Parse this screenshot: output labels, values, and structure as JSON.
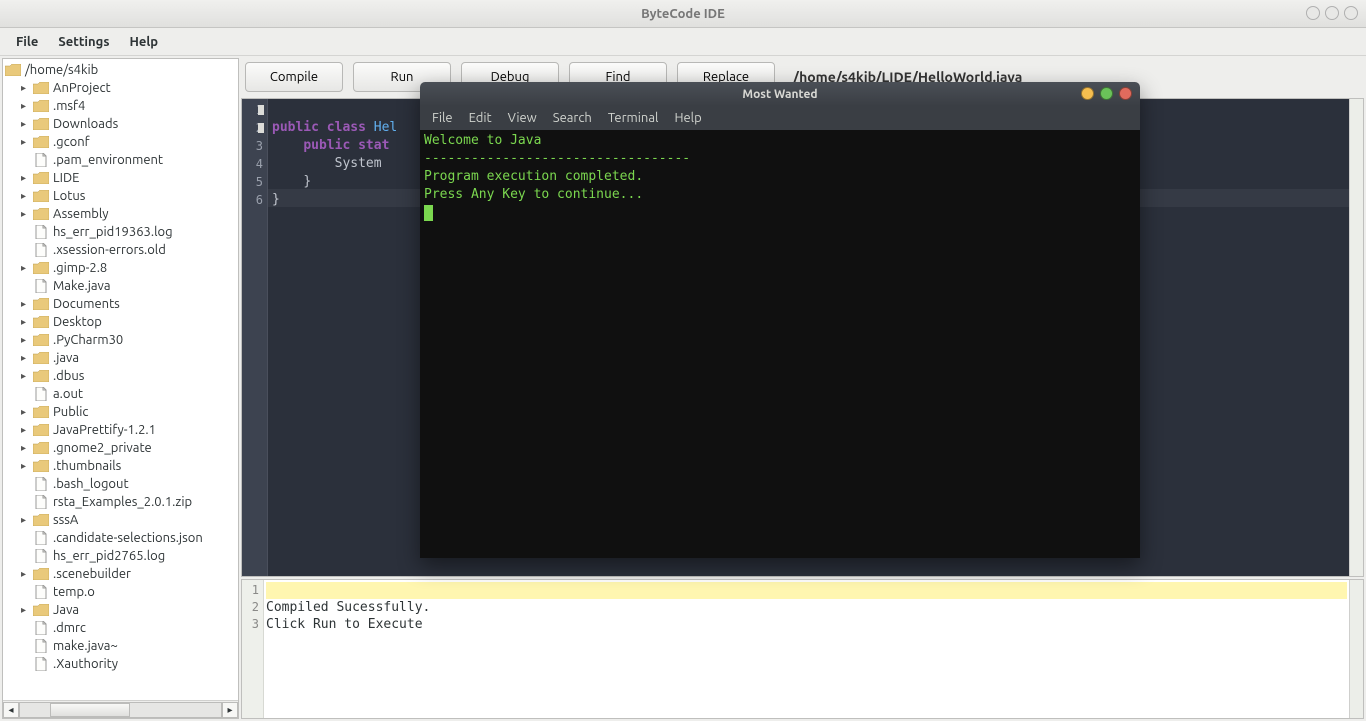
{
  "window": {
    "title": "ByteCode IDE"
  },
  "menubar": [
    "File",
    "Settings",
    "Help"
  ],
  "filetree": {
    "root": "/home/s4kib",
    "nodes": [
      {
        "type": "folder",
        "expandable": true,
        "name": "AnProject"
      },
      {
        "type": "folder",
        "expandable": true,
        "name": ".msf4"
      },
      {
        "type": "folder",
        "expandable": true,
        "name": "Downloads"
      },
      {
        "type": "folder",
        "expandable": true,
        "name": ".gconf"
      },
      {
        "type": "file",
        "expandable": false,
        "name": ".pam_environment"
      },
      {
        "type": "folder",
        "expandable": true,
        "name": "LIDE"
      },
      {
        "type": "folder",
        "expandable": true,
        "name": "Lotus"
      },
      {
        "type": "folder",
        "expandable": true,
        "name": "Assembly"
      },
      {
        "type": "file",
        "expandable": false,
        "name": "hs_err_pid19363.log"
      },
      {
        "type": "file",
        "expandable": false,
        "name": ".xsession-errors.old"
      },
      {
        "type": "folder",
        "expandable": true,
        "name": ".gimp-2.8"
      },
      {
        "type": "file",
        "expandable": false,
        "name": "Make.java"
      },
      {
        "type": "folder",
        "expandable": true,
        "name": "Documents"
      },
      {
        "type": "folder",
        "expandable": true,
        "name": "Desktop"
      },
      {
        "type": "folder",
        "expandable": true,
        "name": ".PyCharm30"
      },
      {
        "type": "folder",
        "expandable": true,
        "name": ".java"
      },
      {
        "type": "folder",
        "expandable": true,
        "name": ".dbus"
      },
      {
        "type": "file",
        "expandable": false,
        "name": "a.out"
      },
      {
        "type": "folder",
        "expandable": true,
        "name": "Public"
      },
      {
        "type": "folder",
        "expandable": true,
        "name": "JavaPrettify-1.2.1"
      },
      {
        "type": "folder",
        "expandable": true,
        "name": ".gnome2_private"
      },
      {
        "type": "folder",
        "expandable": true,
        "name": ".thumbnails"
      },
      {
        "type": "file",
        "expandable": false,
        "name": ".bash_logout"
      },
      {
        "type": "file",
        "expandable": false,
        "name": "rsta_Examples_2.0.1.zip"
      },
      {
        "type": "folder",
        "expandable": true,
        "name": "sssA"
      },
      {
        "type": "file",
        "expandable": false,
        "name": ".candidate-selections.json"
      },
      {
        "type": "file",
        "expandable": false,
        "name": "hs_err_pid2765.log"
      },
      {
        "type": "folder",
        "expandable": true,
        "name": ".scenebuilder"
      },
      {
        "type": "file",
        "expandable": false,
        "name": "temp.o"
      },
      {
        "type": "folder",
        "expandable": true,
        "name": "Java"
      },
      {
        "type": "file",
        "expandable": false,
        "name": ".dmrc"
      },
      {
        "type": "file",
        "expandable": false,
        "name": "make.java~"
      },
      {
        "type": "file",
        "expandable": false,
        "name": ".Xauthority"
      }
    ]
  },
  "toolbar": {
    "compile": "Compile",
    "run": "Run",
    "debug": "Debug",
    "find": "Find",
    "replace": "Replace",
    "path": "/home/s4kib/LIDE/HelloWorld.java"
  },
  "editor": {
    "kw_public": "public",
    "kw_class": "class",
    "cls_name": "Hel",
    "kw_public2": "public",
    "kw_stat": "stat",
    "stmt_system": "System",
    "rbrace": "}",
    "rbrace2": "}",
    "linecount": 6
  },
  "output": {
    "lines": [
      "",
      "Compiled Sucessfully.",
      "Click Run to Execute"
    ]
  },
  "terminal": {
    "title": "Most Wanted",
    "menu": [
      "File",
      "Edit",
      "View",
      "Search",
      "Terminal",
      "Help"
    ],
    "lines": [
      "Welcome to Java",
      "",
      "----------------------------------",
      "Program execution completed.",
      "Press Any Key to continue..."
    ]
  }
}
